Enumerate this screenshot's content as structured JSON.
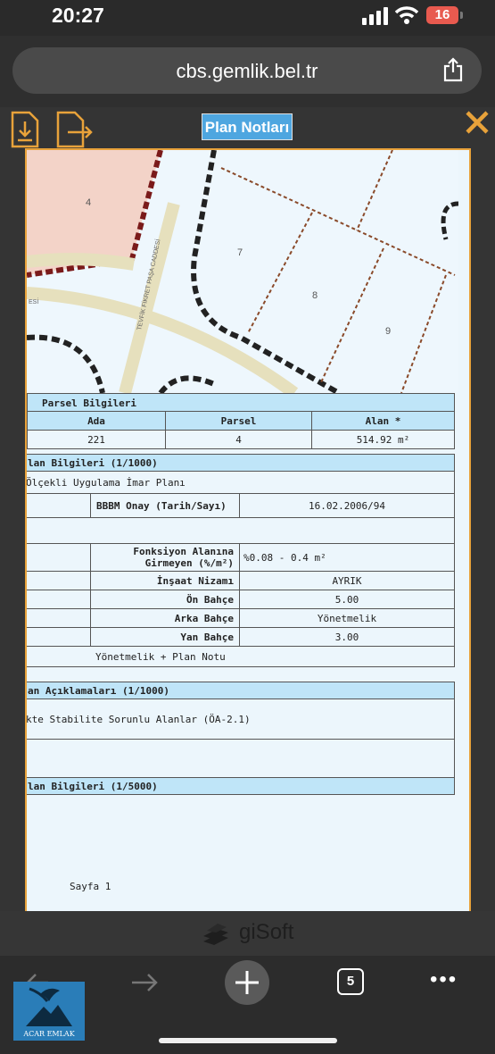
{
  "status": {
    "time": "20:27",
    "battery": "16"
  },
  "browser": {
    "url": "cbs.gemlik.bel.tr"
  },
  "viewer": {
    "title": "Plan Notları",
    "brand": "giSoft"
  },
  "map": {
    "labels": [
      "4",
      "7",
      "8",
      "9"
    ],
    "street": "TEVFİK FİKRET PAŞA CADDESİ",
    "edge_text": "ESİ"
  },
  "parsel": {
    "heading": "Parsel Bilgileri",
    "columns": [
      "Ada",
      "Parsel",
      "Alan *"
    ],
    "values": [
      "221",
      "4",
      "514.92 m²"
    ]
  },
  "plan1000": {
    "heading": "lan Bilgileri (1/1000)",
    "plan_name": "Ölçekli Uygulama İmar Planı",
    "onay_label": "BBBM Onay (Tarih/Sayı)",
    "onay_value": "16.02.2006/94",
    "fonksiyon_label": "Fonksiyon Alanına Girmeyen (%/m²)",
    "fonksiyon_value": "%0.08 - 0.4 m²",
    "insaat_label": "İnşaat Nizamı",
    "insaat_value": "AYRIK",
    "on_label": "Ön Bahçe",
    "on_value": "5.00",
    "arka_label": "Arka Bahçe",
    "arka_value": "Yönetmelik",
    "yan_label": "Yan Bahçe",
    "yan_value": "3.00",
    "note": "Yönetmelik + Plan Notu"
  },
  "aciklama": {
    "heading": "an Açıklamaları (1/1000)",
    "text": "kte Stabilite Sorunlu Alanlar (ÖA-2.1)"
  },
  "plan5000": {
    "heading": "lan Bilgileri (1/5000)"
  },
  "page_label": "Sayfa 1",
  "bottom": {
    "tabs_count": "5",
    "logo_text": "ACAR EMLAK"
  },
  "colors": {
    "accent": "#e8a23a",
    "header_blue": "#bfe5f8",
    "title_blue": "#4ea6e0"
  }
}
